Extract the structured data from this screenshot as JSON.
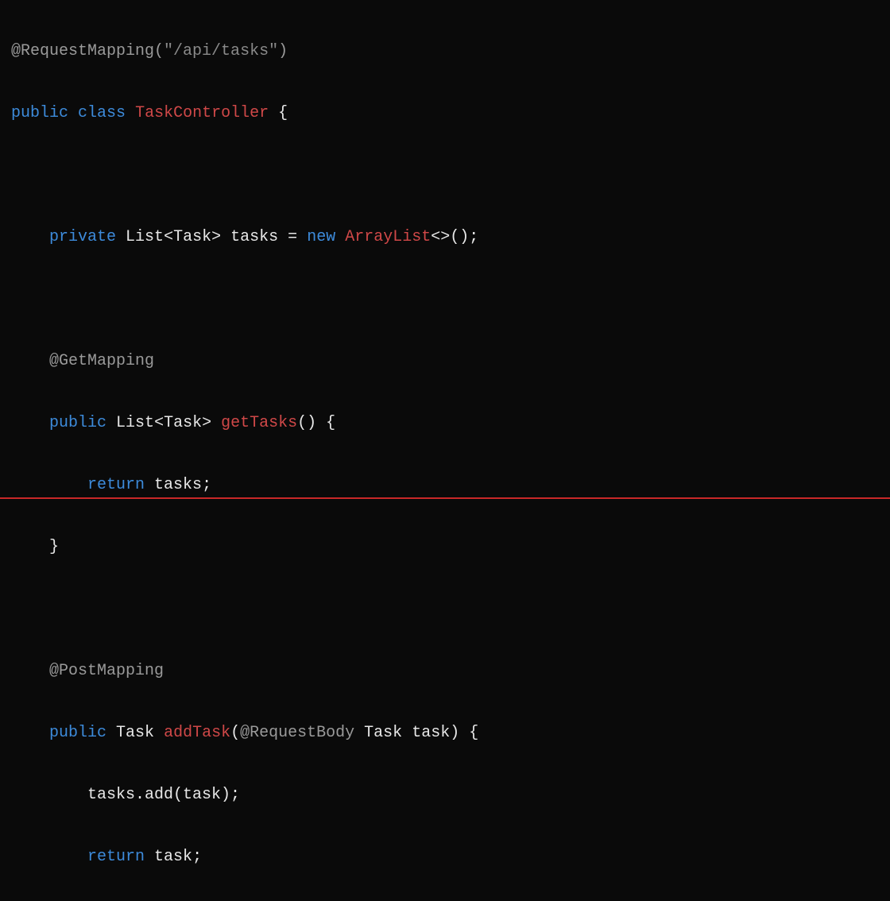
{
  "colors": {
    "keyword_blue": "#3d8bdb",
    "type_red": "#d04848",
    "annotation_gray": "#9a9a9a",
    "string_gray": "#8a8a8a",
    "text_white": "#e8e8e8",
    "background": "#0a0a0a",
    "accent_border": "#c82828"
  },
  "tokens": {
    "l1": {
      "anno": "@RequestMapping",
      "paren_open": "(",
      "str": "\"/api/tasks\"",
      "paren_close": ")"
    },
    "l2": {
      "kw_public": "public",
      "kw_class": "class",
      "type": "TaskController",
      "brace": "{"
    },
    "l3": {
      "kw_private": "private",
      "type_list": "List",
      "lt": "<",
      "type_task": "Task",
      "gt": ">",
      "var": "tasks",
      "eq": "=",
      "kw_new": "new",
      "type_arraylist": "ArrayList",
      "diamond": "<>",
      "tail": "();"
    },
    "l4": {
      "anno": "@GetMapping"
    },
    "l5": {
      "kw_public": "public",
      "type_list": "List",
      "lt": "<",
      "type_task": "Task",
      "gt": ">",
      "method": "getTasks",
      "tail": "() {"
    },
    "l6": {
      "kw_return": "return",
      "var": "tasks",
      "tail": ";"
    },
    "l7": {
      "brace": "}"
    },
    "l8": {
      "anno": "@PostMapping"
    },
    "l9": {
      "kw_public": "public",
      "type_task": "Task",
      "method": "addTask",
      "paren_open": "(",
      "anno_body": "@RequestBody",
      "type_task2": "Task",
      "param": "task",
      "tail": ") {"
    },
    "l10": {
      "expr": "tasks.add(task);"
    },
    "l11": {
      "kw_return": "return",
      "var": "task",
      "tail": ";"
    }
  },
  "indent": {
    "none": "",
    "one": "    ",
    "two": "        "
  }
}
